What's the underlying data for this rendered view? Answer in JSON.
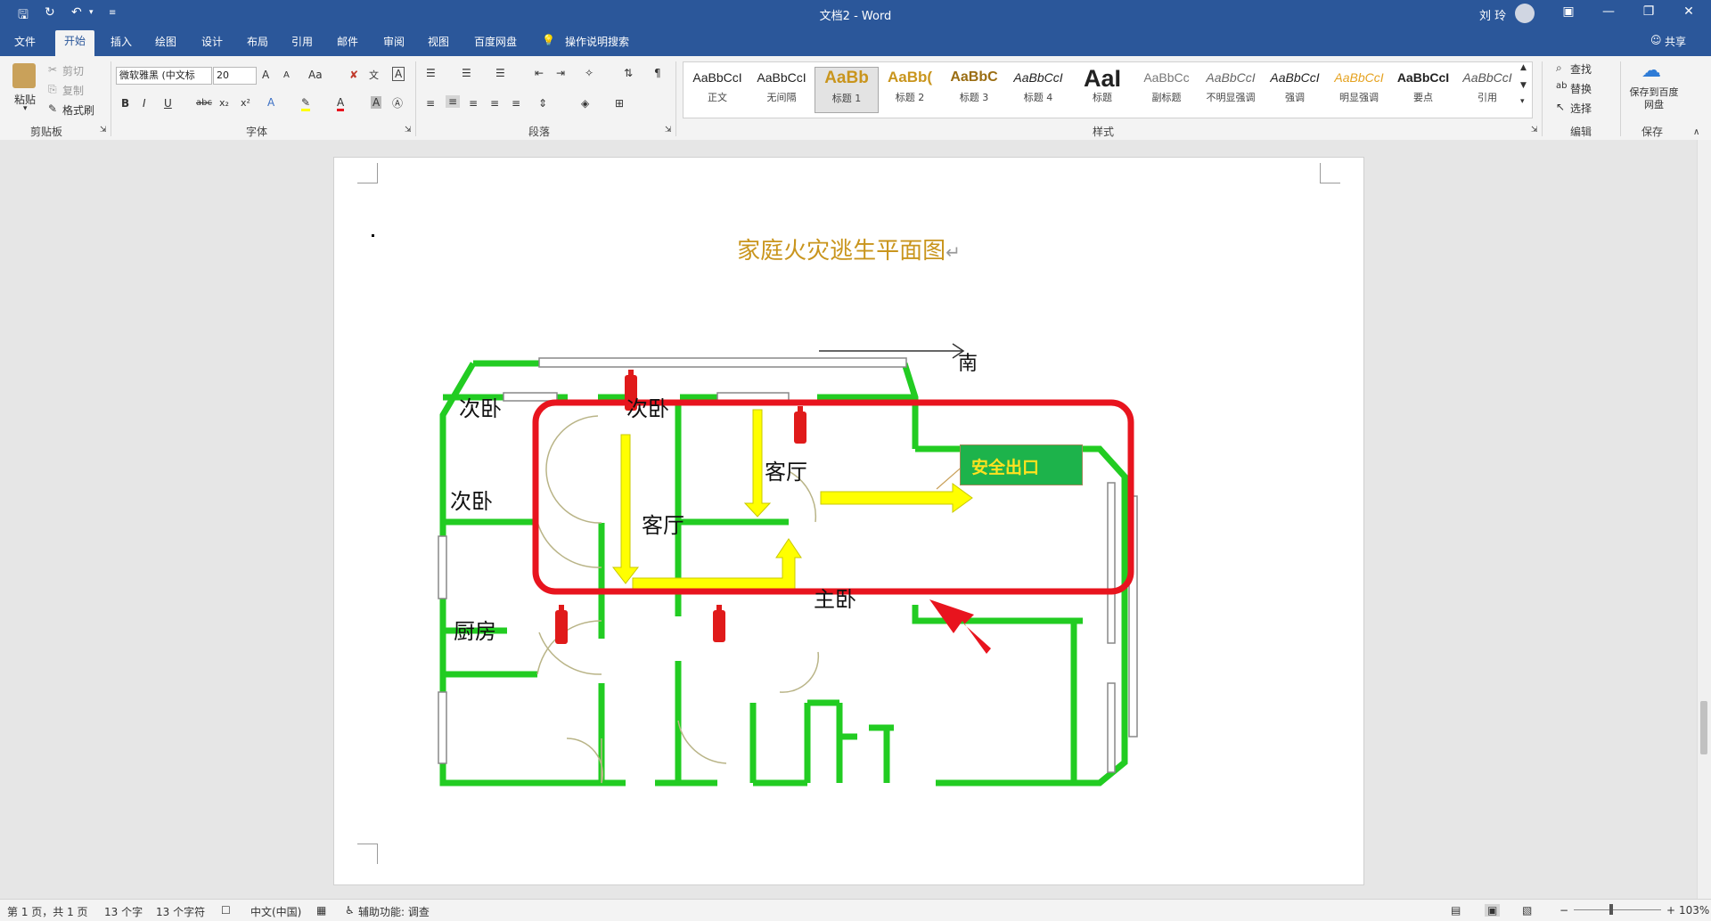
{
  "titlebar": {
    "title": "文档2 - Word",
    "user": "刘 玲",
    "save_icon": "save-icon",
    "undo_icon": "undo-icon"
  },
  "tabs": [
    "文件",
    "开始",
    "插入",
    "绘图",
    "设计",
    "布局",
    "引用",
    "邮件",
    "审阅",
    "视图",
    "百度网盘",
    "操作说明搜索"
  ],
  "share_label": "共享",
  "clipboard": {
    "paste": "粘贴",
    "cut": "剪切",
    "copy": "复制",
    "format_painter": "格式刷",
    "group_label": "剪贴板"
  },
  "font": {
    "name": "微软雅黑 (中文标",
    "size": "20",
    "grow": "A",
    "shrink": "A",
    "case": "Aa",
    "bold": "B",
    "italic": "I",
    "underline": "U",
    "strike": "abc",
    "subscript": "x₂",
    "superscript": "x²",
    "group_label": "字体"
  },
  "paragraph": {
    "group_label": "段落"
  },
  "styles": {
    "group_label": "样式",
    "items": [
      {
        "preview": "AaBbCcI",
        "label": "正文"
      },
      {
        "preview": "AaBbCcI",
        "label": "无间隔"
      },
      {
        "preview": "AaBb",
        "label": "标题 1"
      },
      {
        "preview": "AaBb(",
        "label": "标题 2"
      },
      {
        "preview": "AaBbC",
        "label": "标题 3"
      },
      {
        "preview": "AaBbCcI",
        "label": "标题 4"
      },
      {
        "preview": "AaI",
        "label": "标题"
      },
      {
        "preview": "AaBbCc",
        "label": "副标题"
      },
      {
        "preview": "AaBbCcI",
        "label": "不明显强调"
      },
      {
        "preview": "AaBbCcI",
        "label": "强调"
      },
      {
        "preview": "AaBbCcI",
        "label": "明显强调"
      },
      {
        "preview": "AaBbCcI",
        "label": "要点"
      },
      {
        "preview": "AaBbCcI",
        "label": "引用"
      }
    ]
  },
  "editing": {
    "find": "查找",
    "replace": "替换",
    "select": "选择",
    "group_label": "编辑"
  },
  "save_group": {
    "button": "保存到百度网盘",
    "group_label": "保存"
  },
  "document": {
    "heading": "家庭火灾逃生平面图",
    "heading_color": "#c9951d",
    "direction_label": "南",
    "exit_label": "安全出口",
    "rooms": [
      "次卧",
      "次卧",
      "次卧",
      "厨房",
      "客厅",
      "客厅",
      "主卧"
    ],
    "extinguisher_label": "灭火器"
  },
  "statusbar": {
    "page": "第 1 页，共 1 页",
    "words": "13 个字",
    "chars": "13 个字符",
    "lang": "中文(中国)",
    "accessibility": "辅助功能: 调查",
    "zoom": "103%"
  },
  "colors": {
    "ribbon_blue": "#2b579a",
    "wall_green": "#22cc22",
    "arrow_yellow": "#ffff00",
    "highlight_red": "#e8141e",
    "exit_green": "#1db34b"
  }
}
